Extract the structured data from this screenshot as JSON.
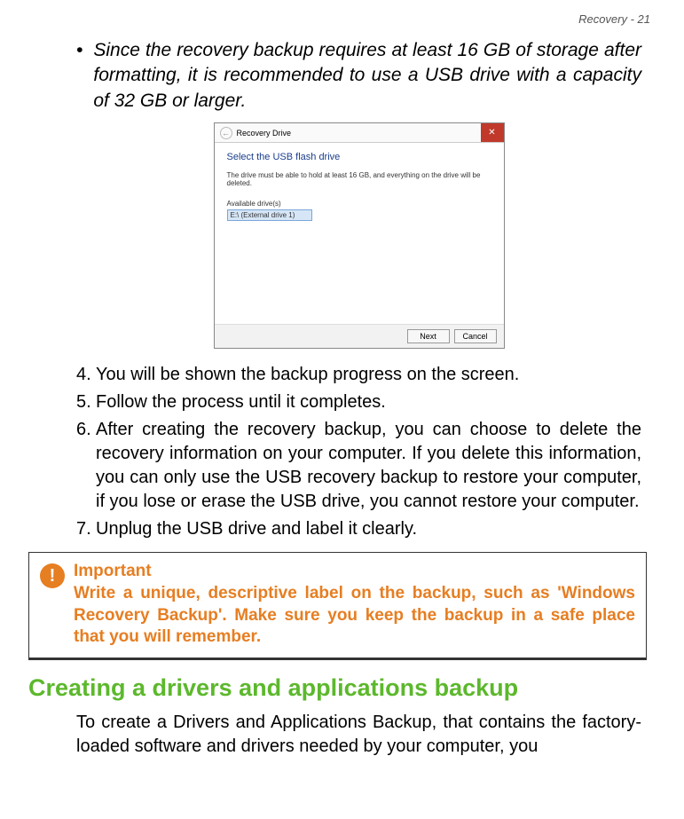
{
  "header": {
    "text": "Recovery - 21"
  },
  "bullet": {
    "marker": "•",
    "text": "Since the recovery backup requires at least 16 GB of storage after formatting, it is recommended to use a USB drive with a capacity of 32 GB or larger."
  },
  "dialog": {
    "title": "Recovery Drive",
    "closeGlyph": "✕",
    "backGlyph": "←",
    "heading": "Select the USB flash drive",
    "sub": "The drive must be able to hold at least 16 GB, and everything on the drive will be deleted.",
    "availableLabel": "Available drive(s)",
    "selected": "E:\\ (External drive 1)",
    "nextLabel": "Next",
    "cancelLabel": "Cancel"
  },
  "steps": {
    "s4num": "4.",
    "s4": "You will be shown the backup progress on the screen.",
    "s5num": "5.",
    "s5": "Follow the process until it completes.",
    "s6num": "6.",
    "s6": "After creating the recovery backup, you can choose to delete the recovery information on your computer. If you delete this information, you can only use the USB recovery backup to restore your computer, if you lose or erase the USB drive, you cannot restore your computer.",
    "s7num": "7.",
    "s7": "Unplug the USB drive and label it clearly."
  },
  "important": {
    "iconGlyph": "!",
    "title": "Important",
    "text": "Write a unique, descriptive label on the backup, such as 'Windows Recovery Backup'. Make sure you keep the backup in a safe place that you will remember."
  },
  "section": {
    "heading": "Creating a drivers and applications backup",
    "para": "To create a Drivers and Applications Backup, that contains the factory-loaded software and drivers needed by your computer, you"
  }
}
